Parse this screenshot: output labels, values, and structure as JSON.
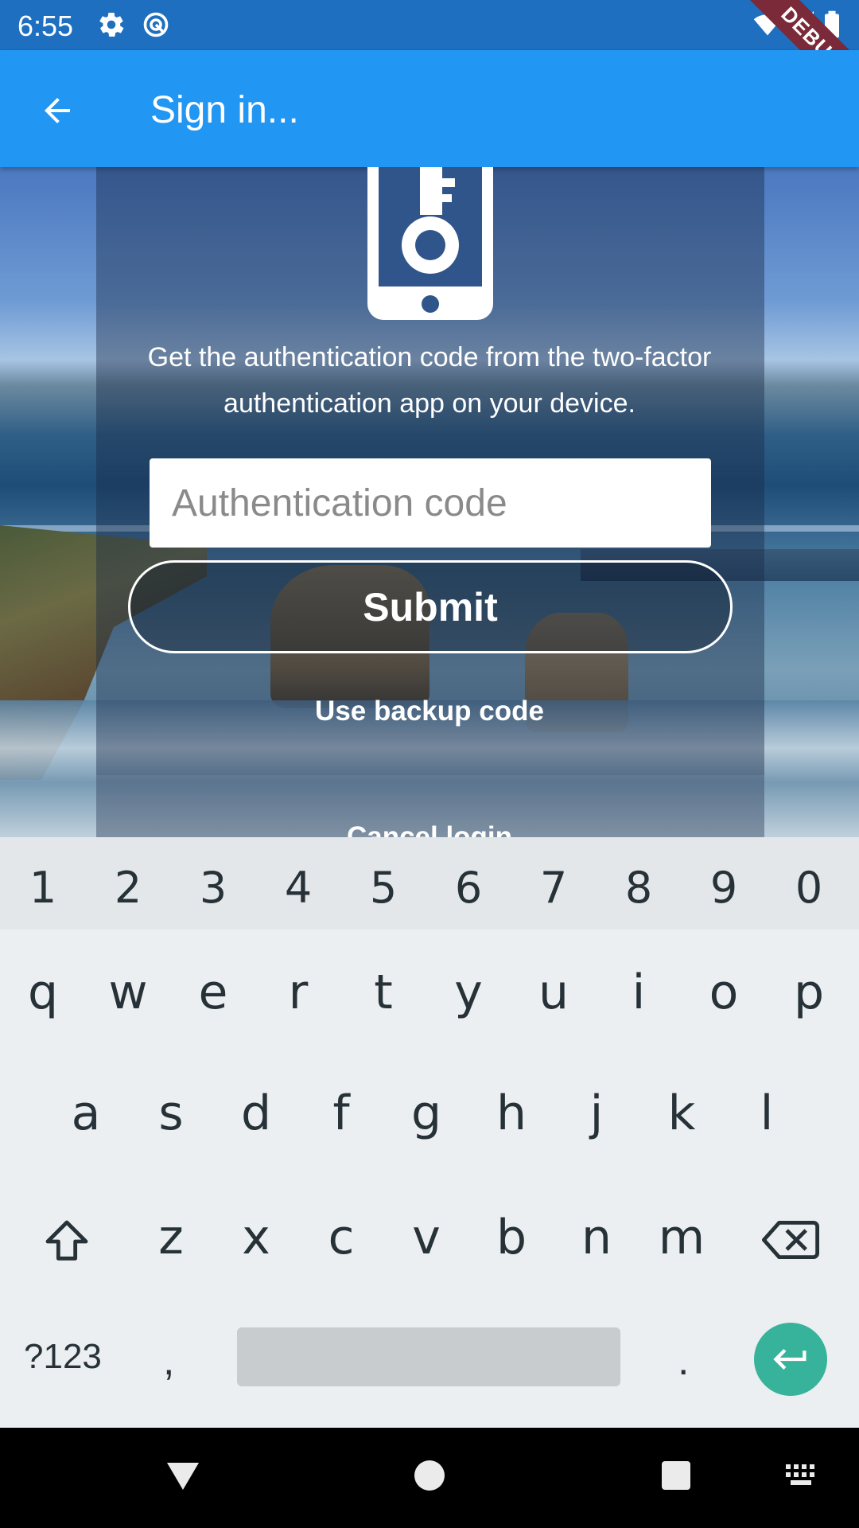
{
  "status_bar": {
    "time": "6:55",
    "debug_label": "DEBUG"
  },
  "app_bar": {
    "title": "Sign in..."
  },
  "content": {
    "instructions": "Get the authentication code from the two-factor authentication app on your device.",
    "auth_input": {
      "placeholder": "Authentication code",
      "value": ""
    },
    "submit_label": "Submit",
    "backup_label": "Use backup code",
    "cancel_label": "Cancel login"
  },
  "keyboard": {
    "number_row": [
      "1",
      "2",
      "3",
      "4",
      "5",
      "6",
      "7",
      "8",
      "9",
      "0"
    ],
    "row1": [
      "q",
      "w",
      "e",
      "r",
      "t",
      "y",
      "u",
      "i",
      "o",
      "p"
    ],
    "row2": [
      "a",
      "s",
      "d",
      "f",
      "g",
      "h",
      "j",
      "k",
      "l"
    ],
    "row3": [
      "z",
      "x",
      "c",
      "v",
      "b",
      "n",
      "m"
    ],
    "symbols_label": "?123",
    "comma": ",",
    "period": ".",
    "accent_color": "#36b39a"
  },
  "colors": {
    "app_bar": "#2196f3",
    "status_bar": "#1e6fc0"
  }
}
